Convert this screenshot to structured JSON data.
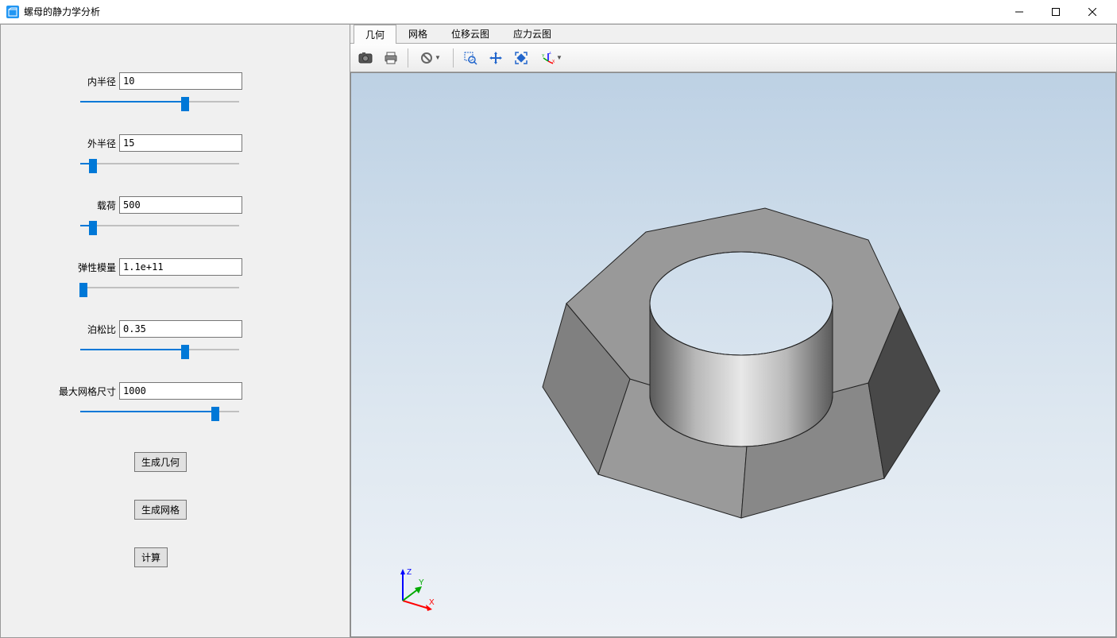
{
  "window": {
    "title": "螺母的静力学分析"
  },
  "sidebar": {
    "params": [
      {
        "label": "内半径",
        "value": "10",
        "fill": 66
      },
      {
        "label": "外半径",
        "value": "15",
        "fill": 8
      },
      {
        "label": "载荷",
        "value": "500",
        "fill": 8
      },
      {
        "label": "弹性模量",
        "value": "1.1e+11",
        "fill": 2,
        "wide": true
      },
      {
        "label": "泊松比",
        "value": "0.35",
        "fill": 66
      },
      {
        "label": "最大网格尺寸",
        "value": "1000",
        "fill": 85,
        "wide": true
      }
    ],
    "buttons": {
      "geom": "生成几何",
      "mesh": "生成网格",
      "calc": "计算"
    }
  },
  "tabs": {
    "items": [
      "几何",
      "网格",
      "位移云图",
      "应力云图"
    ],
    "active": 0
  },
  "toolbar": {
    "icons": [
      "camera-icon",
      "print-icon",
      "no-entry-icon",
      "zoom-area-icon",
      "pan-icon",
      "fit-icon",
      "axis-icon"
    ]
  },
  "axis": {
    "x": "X",
    "y": "Y",
    "z": "Z"
  }
}
